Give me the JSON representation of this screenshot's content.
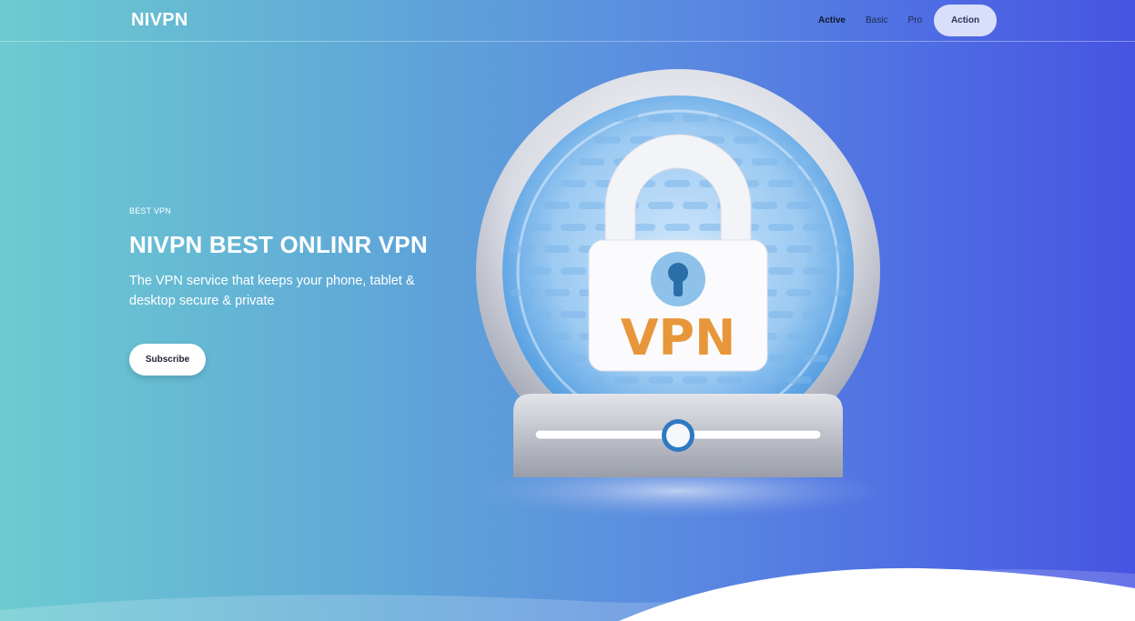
{
  "header": {
    "brand": "NIVPN",
    "nav": [
      {
        "label": "Active"
      },
      {
        "label": "Basic"
      },
      {
        "label": "Pro"
      }
    ],
    "action_label": "Action"
  },
  "hero": {
    "eyebrow": "BEST VPN",
    "title": "NIVPN BEST ONLINR VPN",
    "subtitle": "The VPN service that keeps your phone, tablet & desktop secure & private",
    "cta_label": "Subscribe"
  },
  "illustration": {
    "lock_text": "VPN",
    "icon": "vpn-lock-globe-icon",
    "colors": {
      "lock_text": "#e8963a",
      "globe_blue": "#5ea8e6",
      "keyhole": "#2a6fa8"
    }
  },
  "colors": {
    "gradient_start": "#6ccbd0",
    "gradient_end": "#4754e2",
    "action_button_bg": "#d9defa"
  }
}
